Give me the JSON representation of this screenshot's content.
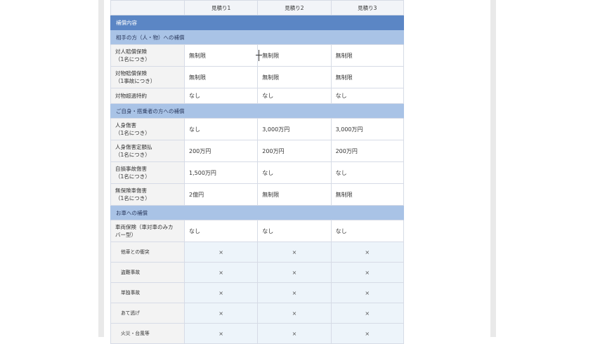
{
  "header": {
    "col1": "見積り1",
    "col2": "見積り2",
    "col3": "見積り3"
  },
  "main_section": "補償内容",
  "sections": [
    {
      "title": "相手の方（人・物）への補償",
      "rows": [
        {
          "label_line1": "対人賠償保険",
          "label_line2": "（1名につき）",
          "v1": "無制限",
          "v2": "無制限",
          "v3": "無制限"
        },
        {
          "label_line1": "対物賠償保険",
          "label_line2": "（1事故につき）",
          "v1": "無制限",
          "v2": "無制限",
          "v3": "無制限"
        },
        {
          "label_line1": "対物超過特約",
          "label_line2": "",
          "v1": "なし",
          "v2": "なし",
          "v3": "なし"
        }
      ]
    },
    {
      "title": "ご自身・搭乗者の方への補償",
      "rows": [
        {
          "label_line1": "人身傷害",
          "label_line2": "（1名につき）",
          "v1": "なし",
          "v2": "3,000万円",
          "v3": "3,000万円"
        },
        {
          "label_line1": "人身傷害定額払",
          "label_line2": "（1名につき）",
          "v1": "200万円",
          "v2": "200万円",
          "v3": "200万円"
        },
        {
          "label_line1": "自損事故傷害",
          "label_line2": "（1名につき）",
          "v1": "1,500万円",
          "v2": "なし",
          "v3": "なし"
        },
        {
          "label_line1": "無保険車傷害",
          "label_line2": "（1名につき）",
          "v1": "2億円",
          "v2": "無制限",
          "v3": "無制限"
        }
      ]
    },
    {
      "title": "お車への補償",
      "rows": [
        {
          "label_line1": "車両保険（車対車のみカ",
          "label_line2": "バー型）",
          "v1": "なし",
          "v2": "なし",
          "v3": "なし"
        }
      ],
      "subrows": [
        {
          "label": "他車との衝突",
          "v1": "×",
          "v2": "×",
          "v3": "×"
        },
        {
          "label": "盗難事故",
          "v1": "×",
          "v2": "×",
          "v3": "×"
        },
        {
          "label": "単独事故",
          "v1": "×",
          "v2": "×",
          "v3": "×"
        },
        {
          "label": "あて逃げ",
          "v1": "×",
          "v2": "×",
          "v3": "×"
        },
        {
          "label": "火災・台風等",
          "v1": "×",
          "v2": "×",
          "v3": "×"
        }
      ]
    }
  ]
}
